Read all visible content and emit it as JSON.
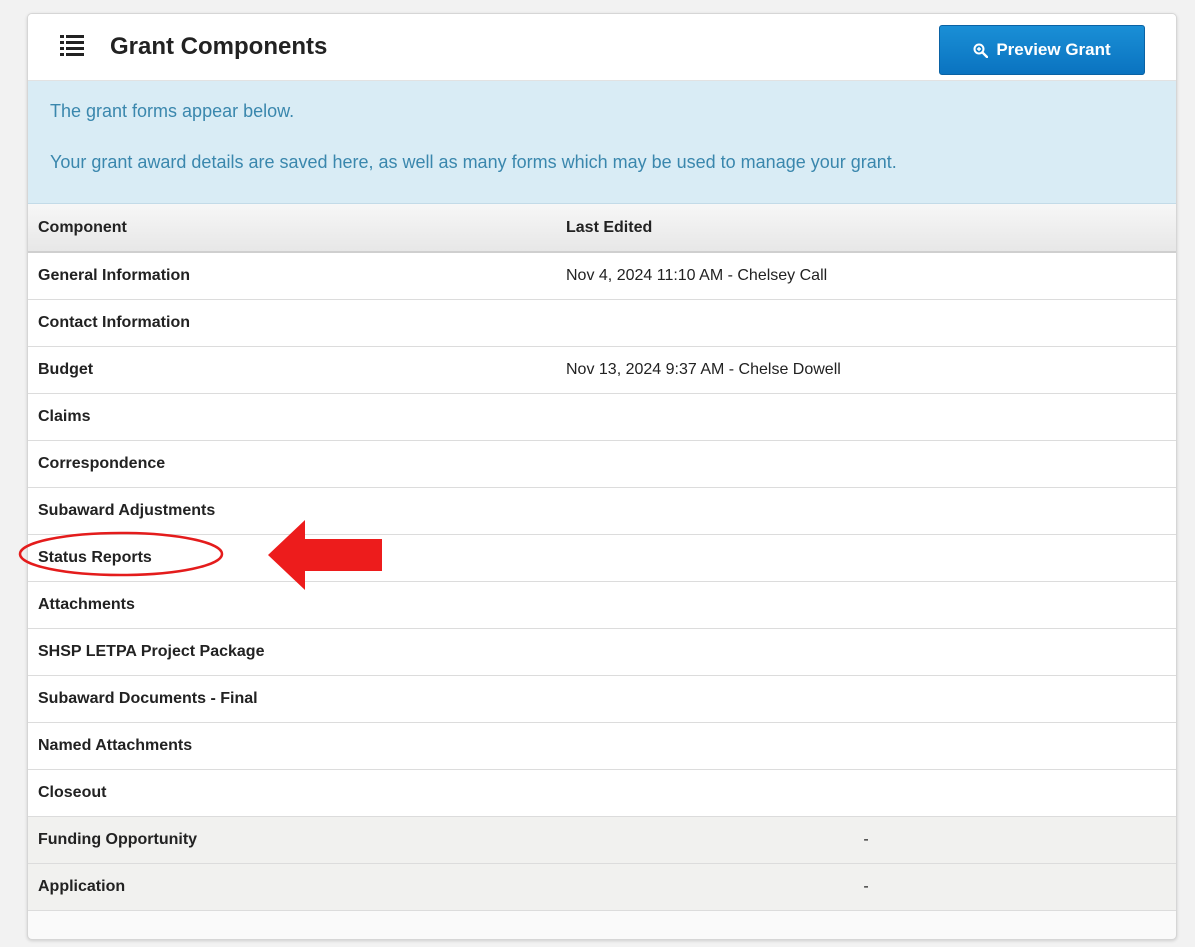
{
  "header": {
    "title": "Grant Components",
    "icon": "list-icon",
    "preview_button": {
      "label": "Preview Grant",
      "icon": "zoom-icon"
    }
  },
  "info": {
    "line1": "The grant forms appear below.",
    "line2": "Your grant award details are saved here, as well as many forms which may be used to manage your grant."
  },
  "table": {
    "columns": [
      "Component",
      "Last Edited"
    ],
    "rows": [
      {
        "component": "General Information",
        "last_edited": "Nov 4, 2024 11:10 AM - Chelsey Call"
      },
      {
        "component": "Contact Information",
        "last_edited": ""
      },
      {
        "component": "Budget",
        "last_edited": "Nov 13, 2024 9:37 AM - Chelse Dowell"
      },
      {
        "component": "Claims",
        "last_edited": ""
      },
      {
        "component": "Correspondence",
        "last_edited": ""
      },
      {
        "component": "Subaward Adjustments",
        "last_edited": ""
      },
      {
        "component": "Status Reports",
        "last_edited": ""
      },
      {
        "component": "Attachments",
        "last_edited": ""
      },
      {
        "component": "SHSP LETPA Project Package",
        "last_edited": ""
      },
      {
        "component": "Subaward Documents - Final",
        "last_edited": ""
      },
      {
        "component": "Named Attachments",
        "last_edited": ""
      },
      {
        "component": "Closeout",
        "last_edited": ""
      },
      {
        "component": "Funding Opportunity",
        "last_edited": "-"
      },
      {
        "component": "Application",
        "last_edited": "-"
      }
    ]
  },
  "annotation": {
    "highlight_color": "#e41c1c",
    "target": "Status Reports"
  },
  "colors": {
    "accent": "#0a73c0",
    "info_bg": "#d9ecf5",
    "info_text": "#3a87ad"
  }
}
